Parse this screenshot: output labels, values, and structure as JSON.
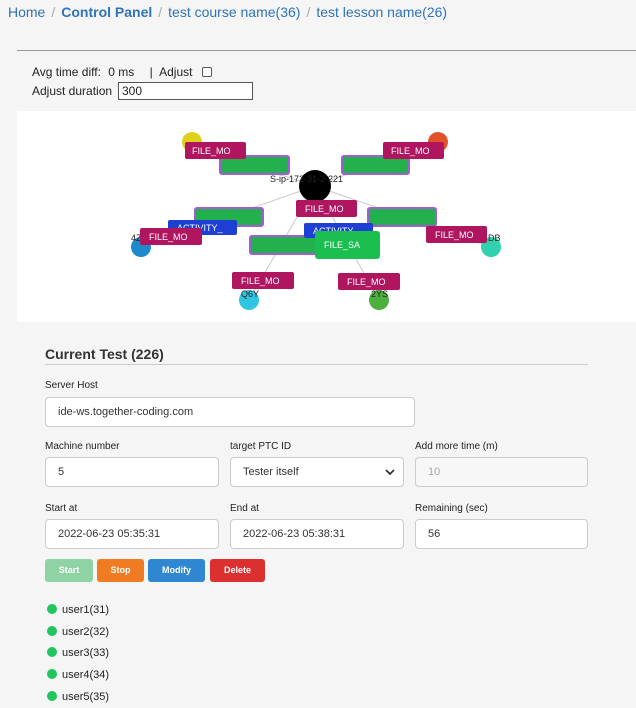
{
  "breadcrumb": [
    "Home",
    "Control Panel",
    "test course name(36)",
    "test lesson name(26)"
  ],
  "controls": {
    "avg_time_label": "Avg time diff:",
    "avg_time_value": "0 ms",
    "separator": "|",
    "adjust_label": "Adjust",
    "adjust_checked": false,
    "adjust_duration_label": "Adjust duration",
    "adjust_duration_value": "300"
  },
  "graph": {
    "host": "S-ip-172-31-2-221",
    "edge_labels": [
      "4Z",
      "DB",
      "Q6Y",
      "2YS"
    ],
    "nodes": [
      {
        "label": "FILE_MO",
        "kind": "file"
      },
      {
        "label": "FILE_MO",
        "kind": "file"
      },
      {
        "label": "FILE_MO",
        "kind": "file"
      },
      {
        "label": "FILE_MO",
        "kind": "file"
      },
      {
        "label": "FILE_MO",
        "kind": "file"
      },
      {
        "label": "FILE_MO",
        "kind": "file"
      },
      {
        "label": "FILE_MO",
        "kind": "file"
      },
      {
        "label": "ACTIVITY_",
        "kind": "activity"
      },
      {
        "label": "ACTIVITY",
        "kind": "activity"
      },
      {
        "label": "FILE_SA",
        "kind": "save"
      }
    ]
  },
  "test": {
    "title": "Current Test (226)",
    "server_host_label": "Server Host",
    "server_host_value": "ide-ws.together-coding.com",
    "machine_label": "Machine number",
    "machine_value": "5",
    "target_label": "target PTC ID",
    "target_value": "Tester itself",
    "add_time_label": "Add more time (m)",
    "add_time_placeholder": "10",
    "start_label": "Start at",
    "start_value": "2022-06-23 05:35:31",
    "end_label": "End at",
    "end_value": "2022-06-23 05:38:31",
    "remaining_label": "Remaining (sec)",
    "remaining_value": "56"
  },
  "buttons": {
    "start": "Start",
    "stop": "Stop",
    "modify": "Modify",
    "delete": "Delete"
  },
  "colors": {
    "start": "#8fd3a4",
    "stop": "#f07b23",
    "modify": "#2f86d1",
    "delete": "#dc2f2f",
    "online": "#21c55d"
  },
  "users": [
    "user1(31)",
    "user2(32)",
    "user3(33)",
    "user4(34)",
    "user5(35)"
  ]
}
